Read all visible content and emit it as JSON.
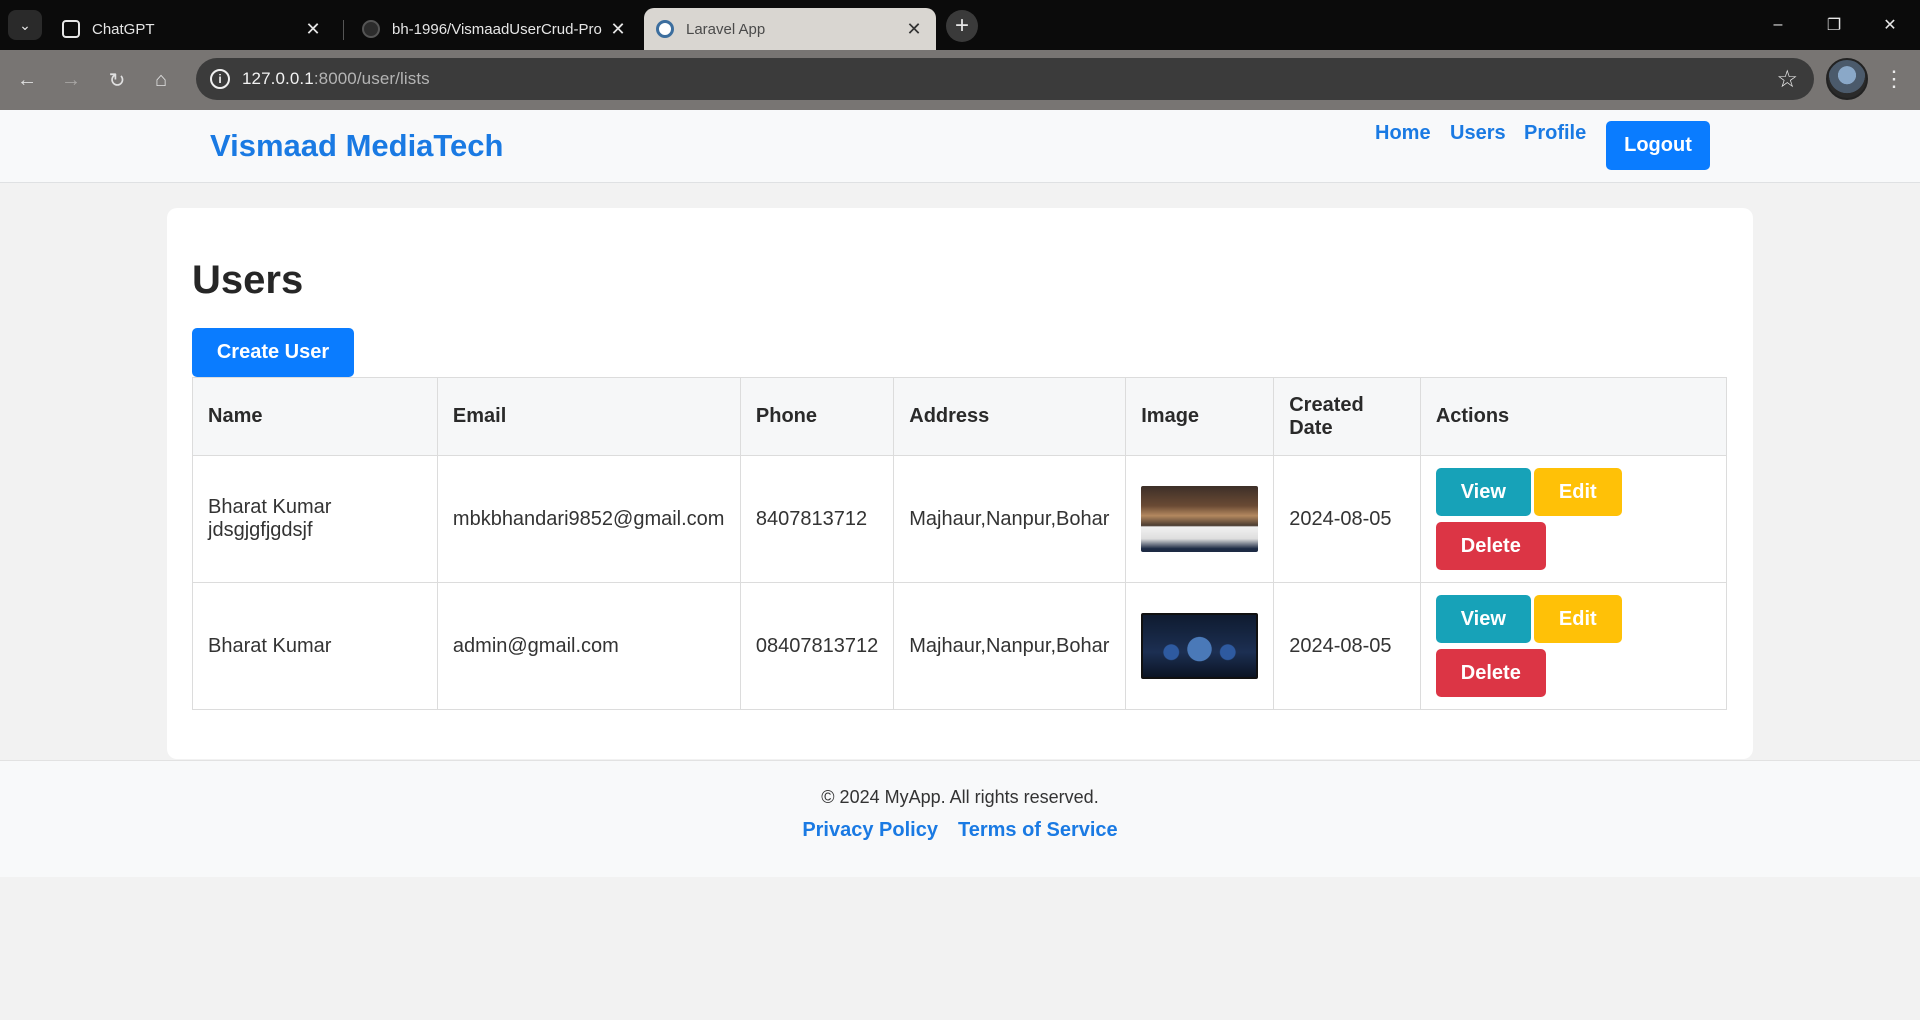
{
  "browser": {
    "tabs": [
      {
        "title": "ChatGPT",
        "favicon": "chatgpt-icon",
        "active": false
      },
      {
        "title": "bh-1996/VismaadUserCrud-Pro",
        "favicon": "github-icon",
        "active": false
      },
      {
        "title": "Laravel App",
        "favicon": "laravel-icon",
        "active": true
      }
    ],
    "url_host": "127.0.0.1",
    "url_path": ":8000/user/lists"
  },
  "header": {
    "brand": "Vismaad MediaTech",
    "nav": [
      "Home",
      "Users",
      "Profile"
    ],
    "logout_label": "Logout"
  },
  "main": {
    "title": "Users",
    "create_label": "Create User",
    "columns": [
      "Name",
      "Email",
      "Phone",
      "Address",
      "Image",
      "Created Date",
      "Actions"
    ],
    "rows": [
      {
        "name": "Bharat Kumar jdsgjgfjgdsjf",
        "email": "mbkbhandari9852@gmail.com",
        "phone": "8407813712",
        "address": "Majhaur,Nanpur,Bohar",
        "created": "2024-08-05"
      },
      {
        "name": "Bharat Kumar",
        "email": "admin@gmail.com",
        "phone": "08407813712",
        "address": "Majhaur,Nanpur,Bohar",
        "created": "2024-08-05"
      }
    ],
    "actions": {
      "view": "View",
      "edit": "Edit",
      "delete": "Delete"
    }
  },
  "footer": {
    "copyright": "© 2024 MyApp. All rights reserved.",
    "links": [
      "Privacy Policy",
      "Terms of Service"
    ]
  },
  "colors": {
    "primary": "#0a7cff",
    "brand": "#1a7ae3",
    "info": "#17a2b8",
    "warning": "#ffc107",
    "danger": "#dc3545"
  }
}
